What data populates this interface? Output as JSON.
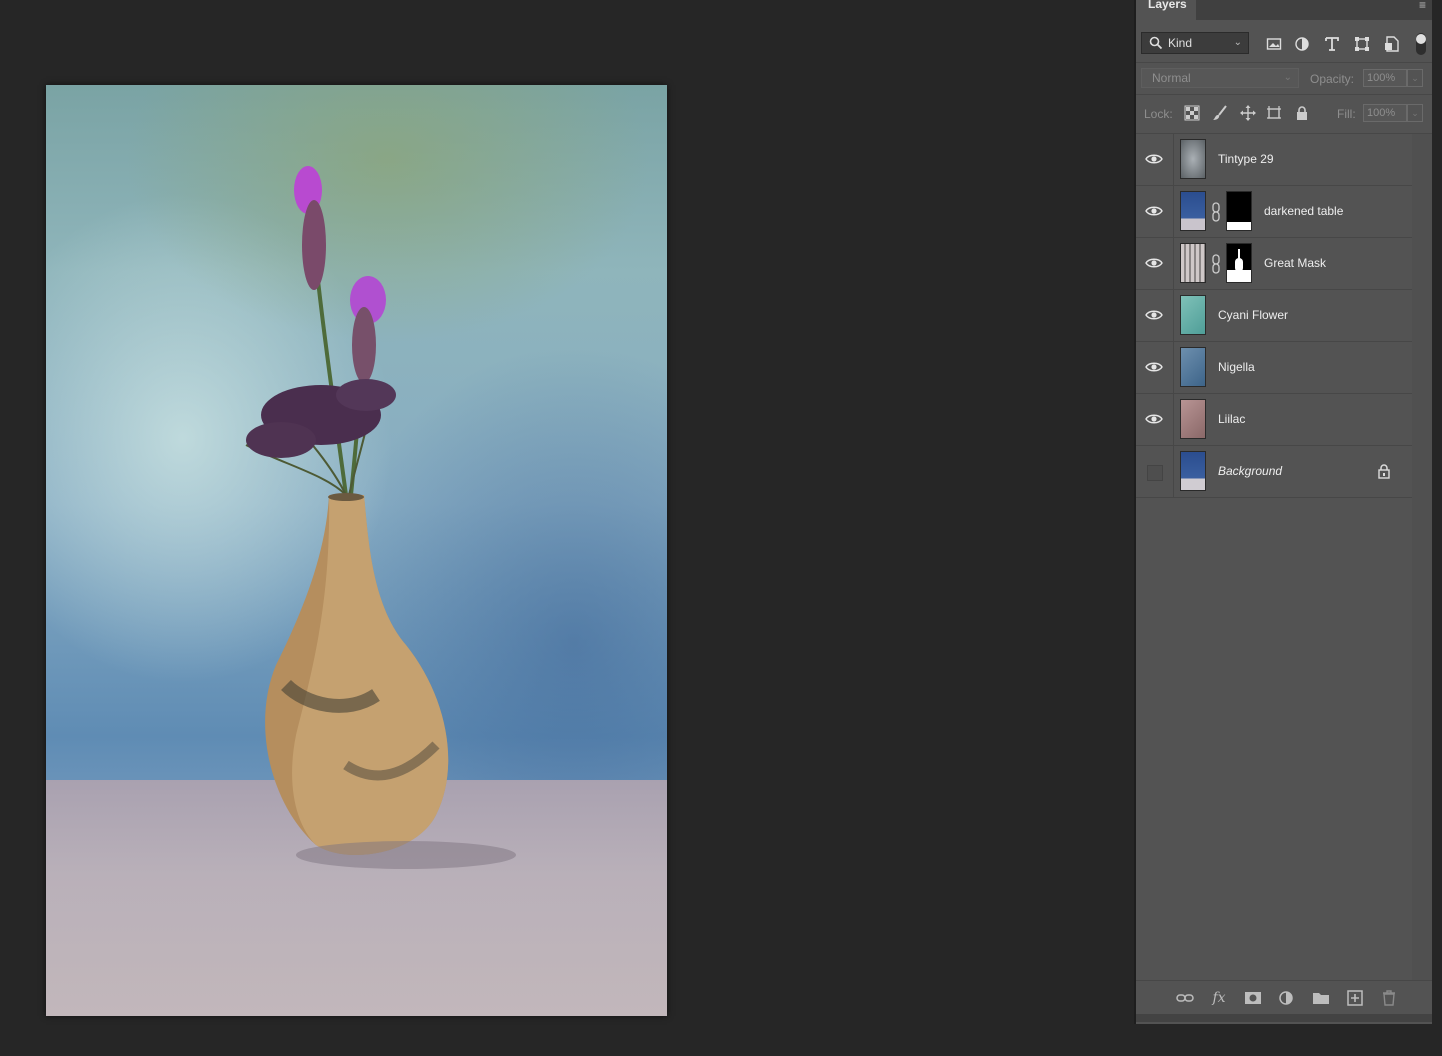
{
  "layers_panel": {
    "tab_label": "Layers",
    "menu_icon": "panel-menu-icon",
    "filter": {
      "kind_label": "Kind"
    },
    "blend_mode": "Normal",
    "opacity_label": "Opacity:",
    "opacity_value": "100%",
    "lock_label": "Lock:",
    "fill_label": "Fill:",
    "fill_value": "100%",
    "layers": [
      {
        "name": "Tintype 29",
        "visible": true,
        "has_mask": false,
        "locked": false,
        "italic": false
      },
      {
        "name": "darkened table",
        "visible": true,
        "has_mask": true,
        "locked": false,
        "italic": false
      },
      {
        "name": "Great Mask",
        "visible": true,
        "has_mask": true,
        "locked": false,
        "italic": false
      },
      {
        "name": "Cyani Flower",
        "visible": true,
        "has_mask": false,
        "locked": false,
        "italic": false
      },
      {
        "name": "Nigella",
        "visible": true,
        "has_mask": false,
        "locked": false,
        "italic": false
      },
      {
        "name": "Liilac",
        "visible": true,
        "has_mask": false,
        "locked": false,
        "italic": false
      },
      {
        "name": "Background",
        "visible": false,
        "has_mask": false,
        "locked": true,
        "italic": true
      }
    ],
    "footer_buttons": [
      "link-layers-icon",
      "fx-icon",
      "add-mask-icon",
      "adjustment-layer-icon",
      "new-group-icon",
      "new-layer-icon",
      "delete-layer-icon"
    ],
    "fx_label": "fx"
  },
  "colors": {
    "workspace_bg": "#262626",
    "panel_bg": "#535353",
    "text": "#eeeeee"
  }
}
